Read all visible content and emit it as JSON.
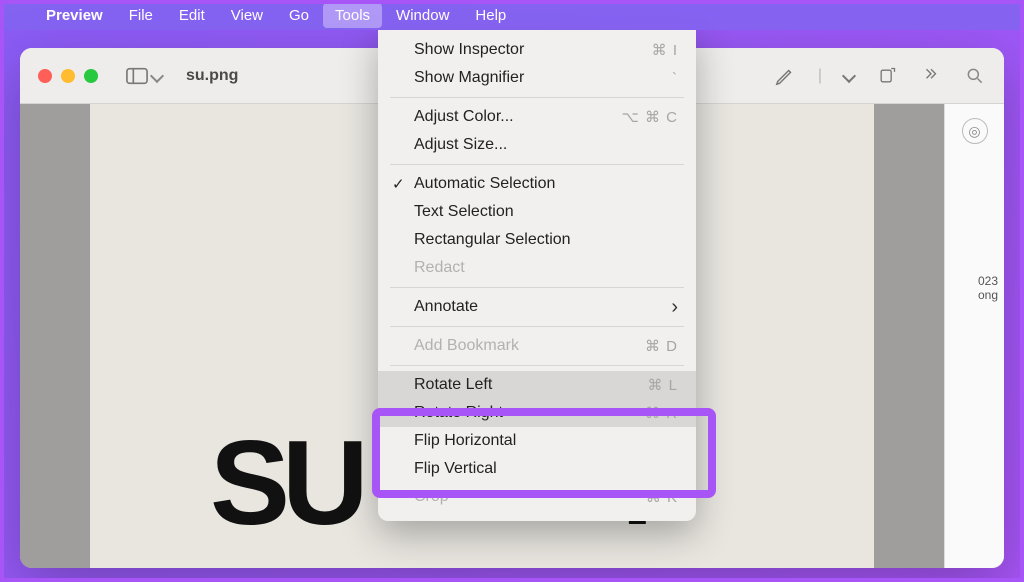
{
  "menubar": {
    "app_name": "Preview",
    "items": [
      "File",
      "Edit",
      "View",
      "Go",
      "Tools",
      "Window",
      "Help"
    ],
    "active_index": 4
  },
  "window": {
    "title": "su.png"
  },
  "document": {
    "text_prefix": "SU",
    "text_suffix": "."
  },
  "side_panel": {
    "line1": "023",
    "line2": "ong"
  },
  "tools_menu": {
    "groups": [
      [
        {
          "label": "Show Inspector",
          "shortcut": "⌘ I",
          "disabled": false
        },
        {
          "label": "Show Magnifier",
          "shortcut": "`",
          "disabled": false
        }
      ],
      [
        {
          "label": "Adjust Color...",
          "shortcut": "⌥ ⌘ C",
          "disabled": false
        },
        {
          "label": "Adjust Size...",
          "shortcut": "",
          "disabled": false
        }
      ],
      [
        {
          "label": "Automatic Selection",
          "shortcut": "",
          "checked": true
        },
        {
          "label": "Text Selection",
          "shortcut": ""
        },
        {
          "label": "Rectangular Selection",
          "shortcut": ""
        },
        {
          "label": "Redact",
          "shortcut": "",
          "disabled": true
        }
      ],
      [
        {
          "label": "Annotate",
          "submenu": true
        }
      ],
      [
        {
          "label": "Add Bookmark",
          "shortcut": "⌘ D",
          "disabled": true
        }
      ],
      [
        {
          "label": "Rotate Left",
          "shortcut": "⌘ L",
          "hover": true
        },
        {
          "label": "Rotate Right",
          "shortcut": "⌘ R",
          "hover": true
        },
        {
          "label": "Flip Horizontal",
          "shortcut": ""
        },
        {
          "label": "Flip Vertical",
          "shortcut": ""
        },
        {
          "label": "Crop",
          "shortcut": "⌘ K",
          "disabled": true
        }
      ]
    ]
  }
}
